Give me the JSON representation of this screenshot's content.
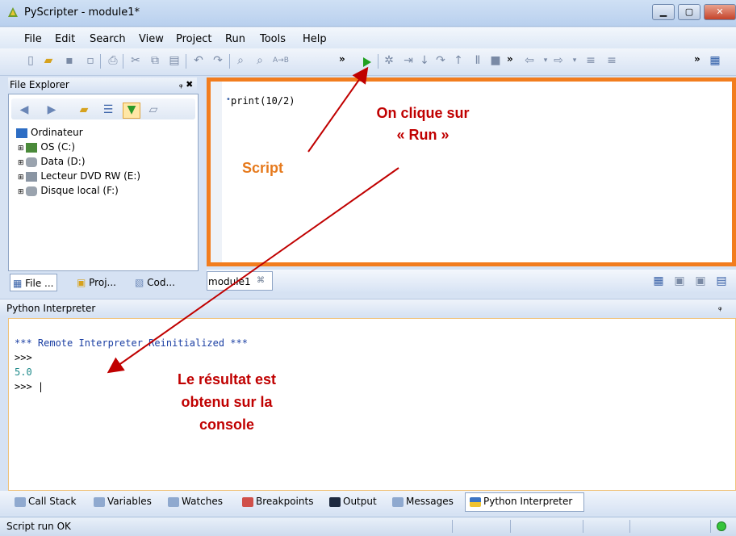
{
  "window": {
    "title": "PyScripter - module1*"
  },
  "menu": {
    "items": [
      "File",
      "Edit",
      "Search",
      "View",
      "Project",
      "Run",
      "Tools",
      "Help"
    ]
  },
  "file_explorer": {
    "title": "File Explorer",
    "pin": "$ ✖",
    "tree": [
      "Ordinateur",
      "OS (C:)",
      "Data (D:)",
      "Lecteur DVD RW (E:)",
      "Disque local (F:)"
    ],
    "tabs": [
      "File ...",
      "Proj...",
      "Cod..."
    ]
  },
  "editor": {
    "code": "print(10/2)",
    "tab": "module1",
    "tab_close": "⌘"
  },
  "interpreter": {
    "title": "Python Interpreter",
    "lines": [
      "*** Remote Interpreter Reinitialized  ***",
      ">>>",
      "5.0",
      ">>> |"
    ]
  },
  "bottom_tabs": [
    "Call Stack",
    "Variables",
    "Watches",
    "Breakpoints",
    "Output",
    "Messages",
    "Python Interpreter"
  ],
  "status": {
    "text": "Script run OK"
  },
  "annotations": {
    "run_line1": "On clique sur",
    "run_line2": "« Run »",
    "script": "Script",
    "result_line1": "Le résultat est",
    "result_line2": "obtenu sur la",
    "result_line3": "console"
  },
  "colors": {
    "editor_frame": "#f27d1e",
    "annotation_red": "#c00000",
    "annotation_orange": "#e67a1d",
    "console_blue": "#1b3fa3",
    "console_result": "#1f8a8a"
  }
}
